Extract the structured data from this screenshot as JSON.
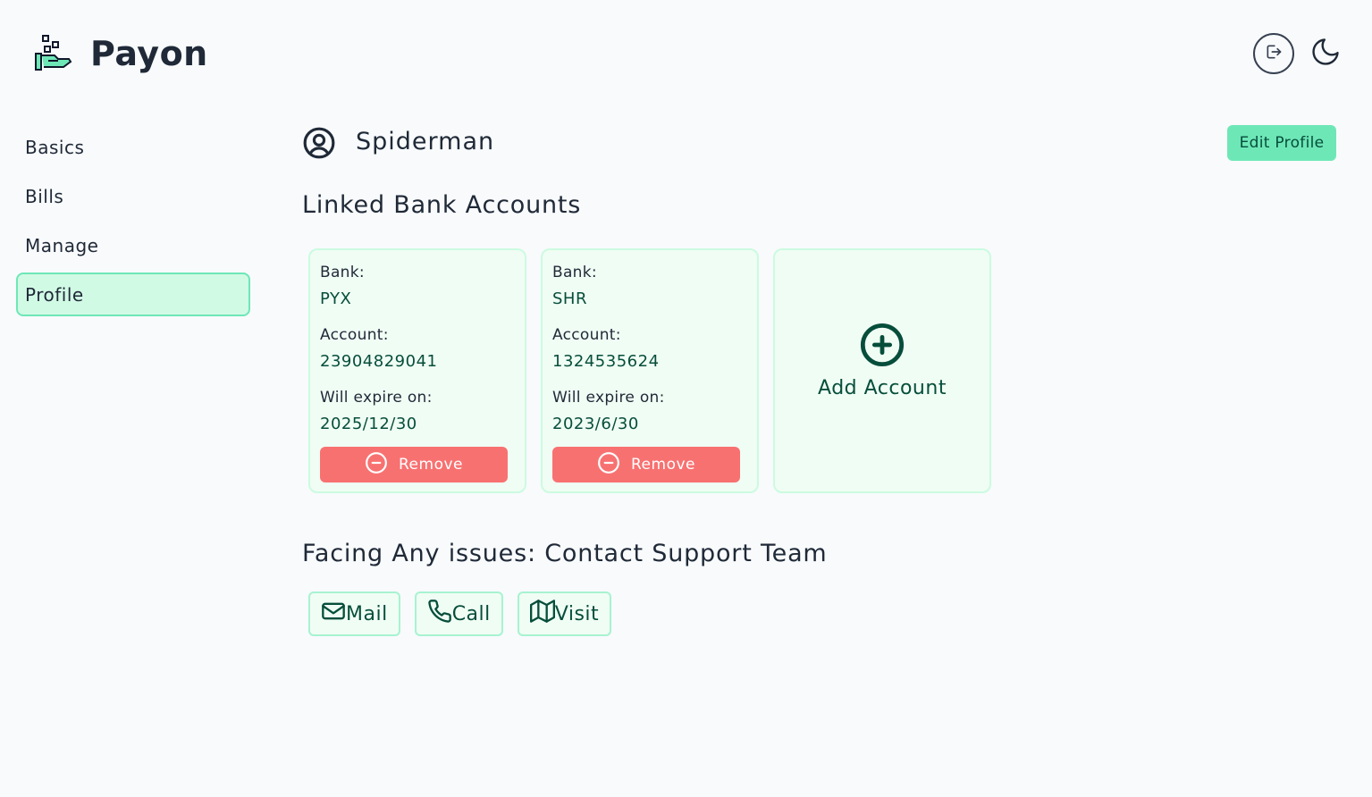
{
  "app": {
    "name": "Payon",
    "logo_icon": "hand-coins-icon"
  },
  "header": {
    "logout_icon": "logout-icon",
    "theme_icon": "moon-icon"
  },
  "sidebar": {
    "items": [
      {
        "label": "Basics",
        "active": false
      },
      {
        "label": "Bills",
        "active": false
      },
      {
        "label": "Manage",
        "active": false
      },
      {
        "label": "Profile",
        "active": true
      }
    ]
  },
  "profile": {
    "user_icon": "user-circle-icon",
    "name": "Spiderman",
    "edit_label": "Edit Profile"
  },
  "accounts": {
    "title": "Linked Bank Accounts",
    "bank_label": "Bank:",
    "account_label": "Account:",
    "expire_label": "Will expire on:",
    "remove_label": "Remove",
    "items": [
      {
        "bank": "PYX",
        "account": "23904829041",
        "expires": "2025/12/30"
      },
      {
        "bank": "SHR",
        "account": "1324535624",
        "expires": "2023/6/30"
      }
    ],
    "add_label": "Add Account"
  },
  "support": {
    "title": "Facing Any issues: Contact Support Team",
    "mail_label": "Mail",
    "call_label": "Call",
    "visit_label": "Visit"
  },
  "colors": {
    "accent": "#6ee7b7",
    "accent_light": "#d1fae5",
    "card_bg": "#f0fdf4",
    "danger": "#f87171",
    "dark_green": "#064e3b",
    "background": "#f8fafc"
  }
}
